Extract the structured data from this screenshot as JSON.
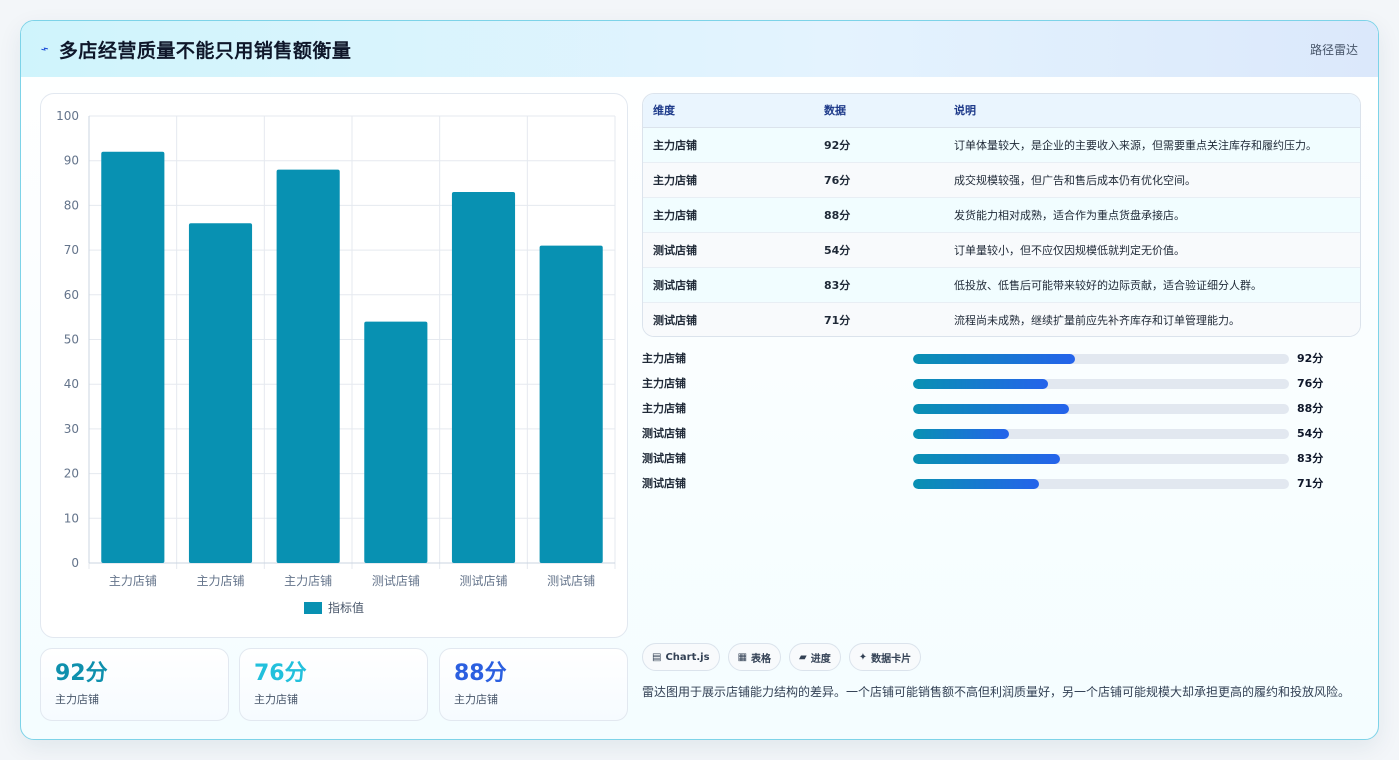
{
  "header": {
    "logo_icon": "⌁",
    "title": "多店经营质量不能只用销售额衡量",
    "tag": "路径雷达"
  },
  "chart_data": {
    "type": "bar",
    "categories": [
      "主力店铺",
      "主力店铺",
      "主力店铺",
      "测试店铺",
      "测试店铺",
      "测试店铺"
    ],
    "series": [
      {
        "name": "指标值",
        "values": [
          92,
          76,
          88,
          54,
          83,
          71
        ],
        "color": "#0891b2"
      }
    ],
    "ylim": [
      0,
      100
    ],
    "yticks": [
      0,
      10,
      20,
      30,
      40,
      50,
      60,
      70,
      80,
      90,
      100
    ],
    "grid": true,
    "legend": "bottom"
  },
  "stats": [
    {
      "value": "92分",
      "label": "主力店铺",
      "color": "#0e90ad"
    },
    {
      "value": "76分",
      "label": "主力店铺",
      "color": "#22c0dc"
    },
    {
      "value": "88分",
      "label": "主力店铺",
      "color": "#2b5fe0"
    }
  ],
  "table": {
    "headers": [
      "维度",
      "数据",
      "说明"
    ],
    "rows": [
      [
        "主力店铺",
        "92分",
        "订单体量较大，是企业的主要收入来源，但需要重点关注库存和履约压力。"
      ],
      [
        "主力店铺",
        "76分",
        "成交规模较强，但广告和售后成本仍有优化空间。"
      ],
      [
        "主力店铺",
        "88分",
        "发货能力相对成熟，适合作为重点货盘承接店。"
      ],
      [
        "测试店铺",
        "54分",
        "订单量较小，但不应仅因规模低就判定无价值。"
      ],
      [
        "测试店铺",
        "83分",
        "低投放、低售后可能带来较好的边际贡献，适合验证细分人群。"
      ],
      [
        "测试店铺",
        "71分",
        "流程尚未成熟，继续扩量前应先补齐库存和订单管理能力。"
      ]
    ]
  },
  "progress": [
    {
      "label": "主力店铺",
      "value": "92分",
      "fraction": 0.43
    },
    {
      "label": "主力店铺",
      "value": "76分",
      "fraction": 0.36
    },
    {
      "label": "主力店铺",
      "value": "88分",
      "fraction": 0.415
    },
    {
      "label": "测试店铺",
      "value": "54分",
      "fraction": 0.255
    },
    {
      "label": "测试店铺",
      "value": "83分",
      "fraction": 0.39
    },
    {
      "label": "测试店铺",
      "value": "71分",
      "fraction": 0.335
    }
  ],
  "chips": [
    {
      "icon": "chart-icon",
      "glyph": "▤",
      "label": "Chart.js"
    },
    {
      "icon": "table-icon",
      "glyph": "▦",
      "label": "表格"
    },
    {
      "icon": "folder-icon",
      "glyph": "▰",
      "label": "进度"
    },
    {
      "icon": "sparkle-icon",
      "glyph": "✦",
      "label": "数据卡片"
    }
  ],
  "note": "雷达图用于展示店铺能力结构的差异。一个店铺可能销售额不高但利润质量好，另一个店铺可能规模大却承担更高的履约和投放风险。"
}
